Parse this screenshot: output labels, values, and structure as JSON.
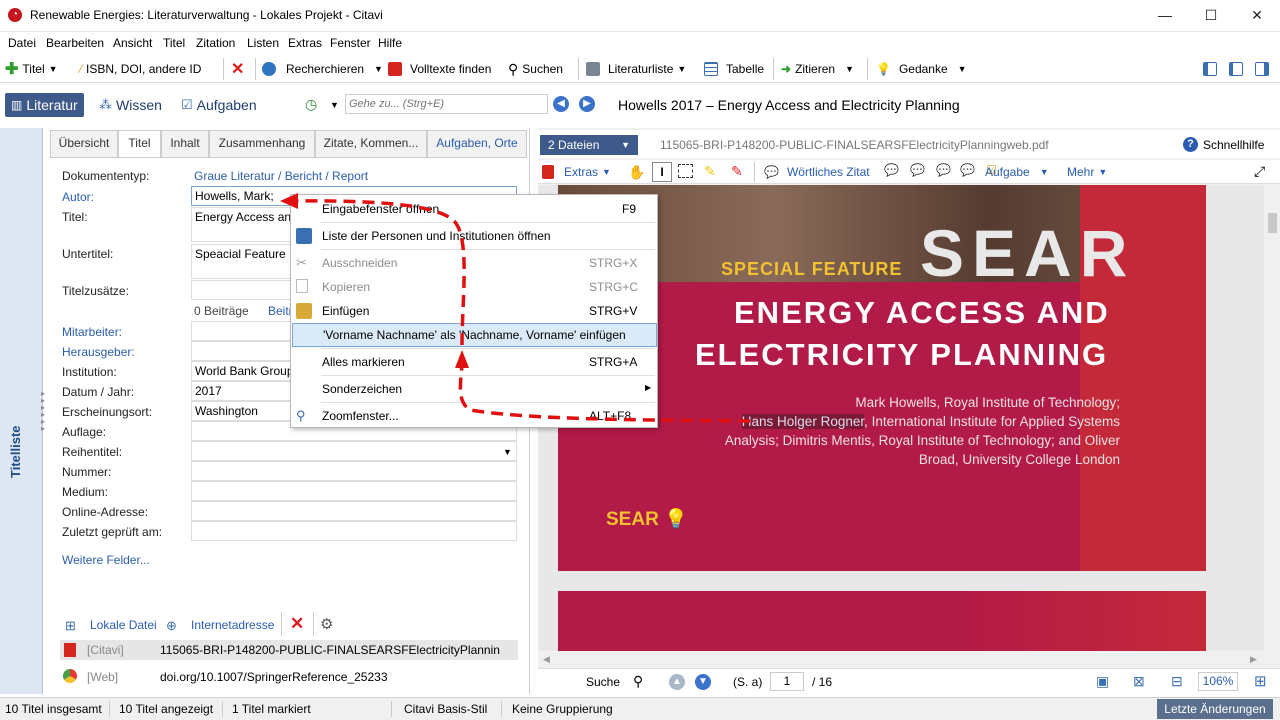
{
  "window": {
    "title": "Renewable Energies: Literaturverwaltung - Lokales Projekt - Citavi",
    "controls": [
      "—",
      "☐",
      "✕"
    ]
  },
  "menu": [
    "Datei",
    "Bearbeiten",
    "Ansicht",
    "Titel",
    "Zitation",
    "Listen",
    "Extras",
    "Fenster",
    "Hilfe"
  ],
  "toolbar": {
    "titel": "Titel",
    "isbn": "ISBN, DOI, andere ID",
    "recherchieren": "Recherchieren",
    "volltexte": "Volltexte finden",
    "suchen": "Suchen",
    "literaturliste": "Literaturliste",
    "tabelle": "Tabelle",
    "zitieren": "Zitieren",
    "gedanke": "Gedanke"
  },
  "nav": {
    "literatur": "Literatur",
    "wissen": "Wissen",
    "aufgaben": "Aufgaben",
    "goto_placeholder": "Gehe zu... (Strg+E)",
    "page_title": "Howells 2017 – Energy Access and Electricity Planning"
  },
  "left_strip": {
    "label": "Titelliste"
  },
  "editor_tabs": [
    "Übersicht",
    "Titel",
    "Inhalt",
    "Zusammenhang",
    "Zitate,  Kommen...",
    "Aufgaben, Orte"
  ],
  "fields": {
    "dokumententyp_label": "Dokumententyp:",
    "dokumententyp_value": "Graue Literatur / Bericht / Report",
    "autor_label": "Autor:",
    "autor_value": "Howells, Mark;",
    "titel_label": "Titel:",
    "titel_value": "Energy Access and",
    "untertitel_label": "Untertitel:",
    "untertitel_value": "Speacial Feature",
    "titelzusaetze_label": "Titelzusätze:",
    "beitraege": "0 Beiträge",
    "beitraege_link": "Beitr",
    "mitarbeiter_label": "Mitarbeiter:",
    "herausgeber_label": "Herausgeber:",
    "institution_label": "Institution:",
    "institution_value": "World Bank Group",
    "datum_label": "Datum / Jahr:",
    "datum_value": "2017",
    "ort_label": "Erscheinungsort:",
    "ort_value": "Washington",
    "auflage_label": "Auflage:",
    "reihentitel_label": "Reihentitel:",
    "nummer_label": "Nummer:",
    "medium_label": "Medium:",
    "online_label": "Online-Adresse:",
    "geprueft_label": "Zuletzt geprüft am:",
    "weitere": "Weitere Felder..."
  },
  "files": {
    "lokale_datei": "Lokale Datei",
    "internetadresse": "Internetadresse",
    "row1_source": "[Citavi]",
    "row1_name": "115065-BRI-P148200-PUBLIC-FINALSEARSFElectricityPlannin",
    "row2_source": "[Web]",
    "row2_name": "doi.org/10.1007/SpringerReference_25233"
  },
  "context_menu": [
    {
      "label": "Eingabefenster öffnen",
      "shortcut": "F9",
      "disabled": false
    },
    {
      "label": "Liste der Personen und Institutionen öffnen",
      "shortcut": "",
      "disabled": false
    },
    {
      "label": "Ausschneiden",
      "shortcut": "STRG+X",
      "disabled": true
    },
    {
      "label": "Kopieren",
      "shortcut": "STRG+C",
      "disabled": true
    },
    {
      "label": "Einfügen",
      "shortcut": "STRG+V",
      "disabled": false
    },
    {
      "label": "'Vorname Nachname' als 'Nachname, Vorname' einfügen",
      "shortcut": "",
      "disabled": false
    },
    {
      "label": "Alles markieren",
      "shortcut": "STRG+A",
      "disabled": false
    },
    {
      "label": "Sonderzeichen",
      "shortcut": "",
      "disabled": false
    },
    {
      "label": "Zoomfenster...",
      "shortcut": "ALT+F8",
      "disabled": false
    }
  ],
  "pdf": {
    "dateien": "2 Dateien",
    "filename": "115065-BRI-P148200-PUBLIC-FINALSEARSFElectricityPlanningweb.pdf",
    "schnellhilfe": "Schnellhilfe",
    "extras": "Extras",
    "woertliches_zitat": "Wörtliches Zitat",
    "aufgabe": "Aufgabe",
    "mehr": "Mehr",
    "sear_big": "SEAR",
    "special_feature": "SPECIAL FEATURE",
    "headline1": "ENERGY ACCESS AND",
    "headline2": "ELECTRICITY PLANNING",
    "authors_pre": "Mark Howells, Royal Institute of Technology;",
    "authors_hl": "Hans Holger Rogner",
    "authors_post": ", International Institute for Applied Systems Analysis; Dimitris Mentis, Royal Institute of Technology; and Oliver Broad, University College London",
    "sear_logo": "SEAR",
    "suche": "Suche",
    "seite_label": "(S. a)",
    "seite_value": "1",
    "seite_total": "/ 16",
    "zoom": "106%"
  },
  "status": {
    "insgesamt": "10 Titel insgesamt",
    "angezeigt": "10 Titel angezeigt",
    "markiert": "1 Titel markiert",
    "stil": "Citavi Basis-Stil",
    "gruppierung": "Keine Gruppierung",
    "letzte": "Letzte Änderungen"
  },
  "colors": {
    "accent": "#3d5a8a",
    "pdf_magenta": "#b21a48",
    "pdf_yellow": "#f2c230",
    "annotation_red": "#e01010"
  }
}
